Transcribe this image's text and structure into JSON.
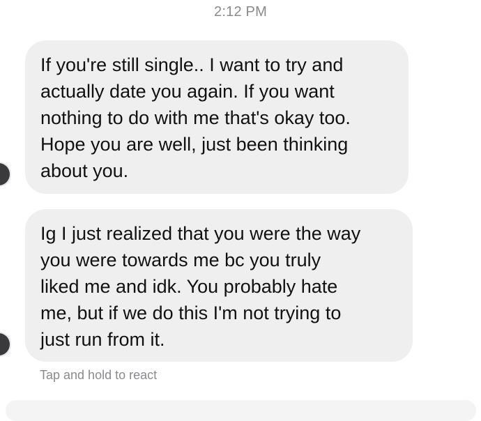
{
  "conversation": {
    "timestamp": "2:12 PM",
    "messages": [
      {
        "text": "If you're still single.. I want to try and\nactually date you again. If you want\nnothing to do with me that's okay too.\nHope you are well, just been thinking\nabout you."
      },
      {
        "text": "Ig I just realized that you were the way\nyou were towards me bc you truly\nliked me and idk. You probably hate\nme, but if we do this I'm not trying to\njust run from it."
      }
    ],
    "react_hint": "Tap and hold to react"
  },
  "colors": {
    "bubble": "#efeff0",
    "secondary_text": "#8a8a8e",
    "avatar": "#3a3a3c"
  }
}
